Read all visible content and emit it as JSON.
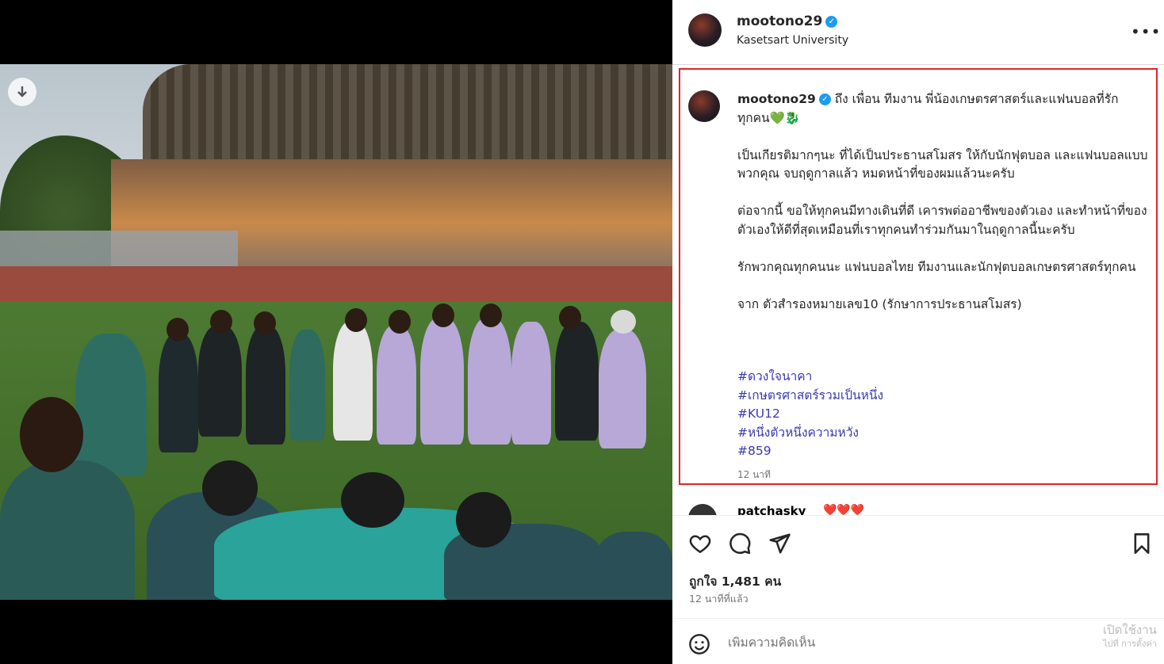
{
  "post": {
    "username": "mootono29",
    "location": "Kasetsart University",
    "more_icon": "more-horizontal-icon"
  },
  "caption": {
    "username": "mootono29",
    "line1": " ถึง เพื่อน ทีมงาน พี่น้องเกษตรศาสตร์และแฟนบอลที่รัก",
    "line2": "ทุกคน💚🐉",
    "para1": "เป็นเกียรติมากๆนะ ที่ได้เป็นประธานสโมสร ให้กับนักฟุตบอล และแฟนบอลแบบพวกคุณ จบฤดูกาลแล้ว หมดหน้าที่ของผมแล้วนะครับ",
    "para2": "ต่อจากนี้ ขอให้ทุกคนมีทางเดินที่ดี เคารพต่ออาชีพของตัวเอง และทำหน้าที่ของตัวเองให้ดีที่สุดเหมือนที่เราทุกคนทำร่วมกันมาในฤดูกาลนี้นะครับ",
    "para3": "รักพวกคุณทุกคนนะ แฟนบอลไทย ทีมงานและนักฟุตบอลเกษตรศาสตร์ทุกคน",
    "para4": "จาก ตัวสำรองหมายเลข10 (รักษาการประธานสโมสร)",
    "hashtags": [
      "#ดวงใจนาคา",
      "#เกษตรศาสตร์รวมเป็นหนึ่ง",
      "#KU12",
      "#หนึ่งตัวหนึ่งความหวัง",
      "#859"
    ],
    "time": "12 นาที"
  },
  "next_comment": {
    "username": "patchasky",
    "text": "❤️❤️❤️"
  },
  "actions": {
    "likes": "ถูกใจ 1,481 คน",
    "posted_ago": "12 นาทีที่แล้ว"
  },
  "comment": {
    "placeholder": "เพิ่มความคิดเห็น"
  },
  "watermark": {
    "line1": "เปิดใช้งาน",
    "line2": "ไปที่ การตั้งค่า"
  },
  "colors": {
    "highlight_border": "#e0232a",
    "verified_badge": "#1d9bf0",
    "hashtag": "#3a3ab0"
  }
}
